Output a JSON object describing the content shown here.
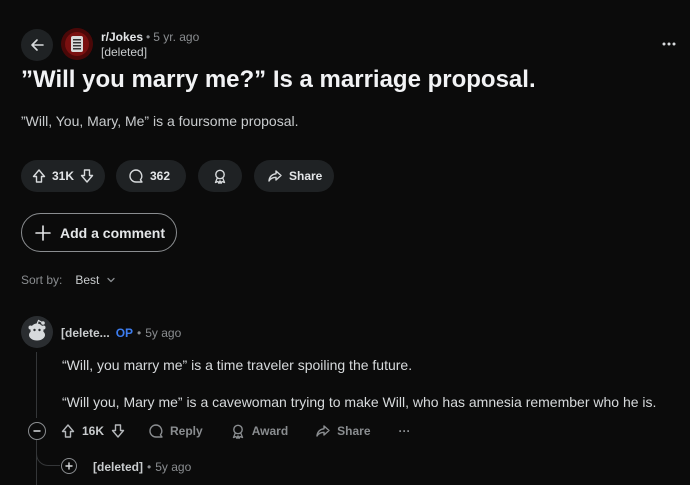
{
  "post": {
    "subreddit": "r/Jokes",
    "time_ago": "5 yr. ago",
    "separator": "•",
    "author": "[deleted]",
    "title": "”Will you marry me?” Is a marriage proposal.",
    "body": "”Will, You, Mary, Me” is a foursome proposal.",
    "score": "31K",
    "comments_count": "362",
    "share_label": "Share"
  },
  "add_comment_label": "Add a comment",
  "sort": {
    "label": "Sort by:",
    "value": "Best"
  },
  "comment": {
    "author": "[delete...",
    "op_badge": "OP",
    "separator": "•",
    "time_ago": "5y ago",
    "paragraphs": [
      "“Will, you marry me” is a time traveler spoiling the future.",
      "“Will you, Mary me” is a cavewoman trying to make Will, who has amnesia remember who he is."
    ],
    "score": "16K",
    "reply_label": "Reply",
    "award_label": "Award",
    "share_label": "Share",
    "more_label": "···"
  },
  "reply": {
    "author": "[deleted]",
    "separator": "•",
    "time_ago": "5y ago"
  },
  "icons": {
    "back": "back-arrow-icon",
    "more": "more-horizontal-icon",
    "upvote": "upvote-icon",
    "downvote": "downvote-icon",
    "comment": "comment-bubble-icon",
    "award": "award-icon",
    "share": "share-arrow-icon",
    "plus": "plus-icon",
    "chevron": "chevron-down-icon",
    "collapse": "collapse-minus-icon",
    "expand": "expand-plus-icon"
  },
  "colors": {
    "background": "#0b0b0b",
    "pill": "#1f2224",
    "op": "#3d7df0",
    "muted": "#8a8d90"
  }
}
